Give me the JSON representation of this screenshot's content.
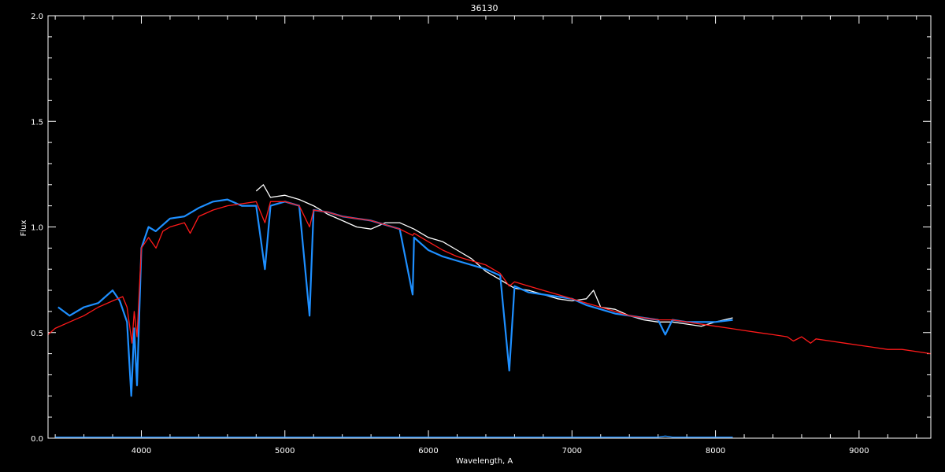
{
  "chart_data": {
    "type": "line",
    "title": "36130",
    "xlabel": "Wavelength, A",
    "ylabel": "Flux",
    "xlim": [
      3350,
      9500
    ],
    "ylim": [
      0.0,
      2.0
    ],
    "x_ticks": [
      4000,
      5000,
      6000,
      7000,
      8000,
      9000
    ],
    "x_tick_labels": [
      "4000",
      "5000",
      "6000",
      "7000",
      "8000",
      "9000"
    ],
    "y_ticks": [
      0.0,
      0.5,
      1.0,
      1.5,
      2.0
    ],
    "y_tick_labels": [
      "0.0",
      "0.5",
      "1.0",
      "1.5",
      "2.0"
    ],
    "grid": false,
    "background": "#000000",
    "series": [
      {
        "color": "#ffffff",
        "x": [
          4800,
          4850,
          4900,
          5000,
          5100,
          5200,
          5300,
          5400,
          5500,
          5600,
          5700,
          5800,
          5900,
          6000,
          6100,
          6200,
          6300,
          6400,
          6500,
          6600,
          6700,
          6800,
          6900,
          7000,
          7100,
          7150,
          7200,
          7300,
          7400,
          7500,
          7600,
          7700,
          7800,
          7900,
          8000,
          8120
        ],
        "y": [
          1.17,
          1.2,
          1.14,
          1.15,
          1.13,
          1.1,
          1.06,
          1.03,
          1.0,
          0.99,
          1.02,
          1.02,
          0.99,
          0.95,
          0.93,
          0.89,
          0.85,
          0.79,
          0.75,
          0.71,
          0.7,
          0.68,
          0.66,
          0.65,
          0.66,
          0.7,
          0.62,
          0.61,
          0.58,
          0.56,
          0.55,
          0.55,
          0.54,
          0.53,
          0.55,
          0.57
        ]
      },
      {
        "color": "#1e8fff",
        "x": [
          3420,
          3500,
          3600,
          3700,
          3800,
          3850,
          3900,
          3930,
          3950,
          3970,
          4000,
          4050,
          4100,
          4200,
          4300,
          4400,
          4500,
          4600,
          4700,
          4800,
          4861,
          4900,
          5000,
          5100,
          5172,
          5200,
          5300,
          5400,
          5500,
          5600,
          5700,
          5800,
          5890,
          5900,
          6000,
          6100,
          6200,
          6300,
          6400,
          6500,
          6563,
          6600,
          6700,
          6800,
          6900,
          7000,
          7100,
          7200,
          7300,
          7400,
          7500,
          7600,
          7650,
          7700,
          7800,
          7900,
          8000,
          8120
        ],
        "y": [
          0.62,
          0.58,
          0.62,
          0.64,
          0.7,
          0.65,
          0.55,
          0.2,
          0.52,
          0.25,
          0.9,
          1.0,
          0.98,
          1.04,
          1.05,
          1.09,
          1.12,
          1.13,
          1.1,
          1.1,
          0.8,
          1.1,
          1.12,
          1.1,
          0.58,
          1.08,
          1.07,
          1.05,
          1.04,
          1.03,
          1.01,
          0.99,
          0.68,
          0.95,
          0.89,
          0.86,
          0.84,
          0.82,
          0.8,
          0.77,
          0.32,
          0.72,
          0.69,
          0.68,
          0.67,
          0.66,
          0.63,
          0.61,
          0.59,
          0.58,
          0.57,
          0.56,
          0.49,
          0.56,
          0.55,
          0.55,
          0.55,
          0.56
        ]
      },
      {
        "color": "#ff1a1a",
        "x": [
          3350,
          3400,
          3500,
          3600,
          3700,
          3800,
          3870,
          3900,
          3935,
          3950,
          3970,
          4000,
          4050,
          4102,
          4150,
          4200,
          4300,
          4340,
          4400,
          4500,
          4600,
          4700,
          4800,
          4861,
          4900,
          5000,
          5100,
          5172,
          5200,
          5300,
          5400,
          5500,
          5600,
          5700,
          5800,
          5890,
          5900,
          6000,
          6100,
          6200,
          6300,
          6400,
          6500,
          6563,
          6600,
          6700,
          6800,
          6900,
          7000,
          7100,
          7200,
          7300,
          7400,
          7500,
          7600,
          7700,
          7800,
          7900,
          8000,
          8100,
          8200,
          8300,
          8400,
          8500,
          8542,
          8600,
          8662,
          8700,
          8800,
          8900,
          9000,
          9100,
          9200,
          9300,
          9400,
          9500
        ],
        "y": [
          0.49,
          0.52,
          0.55,
          0.58,
          0.62,
          0.65,
          0.67,
          0.62,
          0.45,
          0.6,
          0.48,
          0.9,
          0.95,
          0.9,
          0.98,
          1.0,
          1.02,
          0.97,
          1.05,
          1.08,
          1.1,
          1.11,
          1.12,
          1.02,
          1.12,
          1.12,
          1.1,
          1.0,
          1.08,
          1.07,
          1.05,
          1.04,
          1.03,
          1.01,
          0.99,
          0.96,
          0.97,
          0.93,
          0.89,
          0.86,
          0.84,
          0.82,
          0.78,
          0.72,
          0.74,
          0.72,
          0.7,
          0.68,
          0.66,
          0.64,
          0.62,
          0.6,
          0.58,
          0.57,
          0.56,
          0.56,
          0.55,
          0.54,
          0.53,
          0.52,
          0.51,
          0.5,
          0.49,
          0.48,
          0.46,
          0.48,
          0.45,
          0.47,
          0.46,
          0.45,
          0.44,
          0.43,
          0.42,
          0.42,
          0.41,
          0.4
        ]
      },
      {
        "color": "#1e8fff",
        "x": [
          3400,
          4000,
          5000,
          6000,
          7000,
          7600,
          7650,
          7700,
          8120
        ],
        "y": [
          0.005,
          0.005,
          0.005,
          0.005,
          0.005,
          0.005,
          0.01,
          0.005,
          0.005
        ]
      }
    ]
  }
}
